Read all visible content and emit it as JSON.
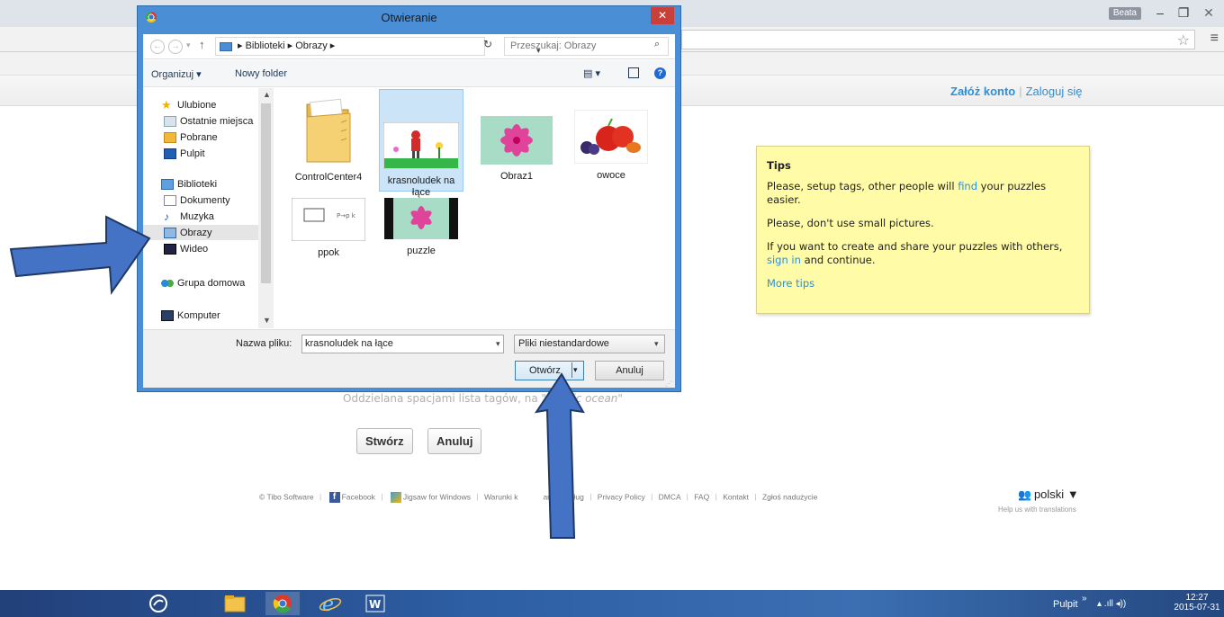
{
  "browser": {
    "user_badge": "Beata",
    "controls": {
      "minimize": "–",
      "maximize": "❐",
      "close": "✕"
    }
  },
  "site": {
    "header": {
      "signup": "Załóż konto",
      "separator": "|",
      "login": "Zaloguj się"
    },
    "tips": {
      "title": "Tips",
      "line1_pre": "Please, setup tags, other people will ",
      "line1_link": "find",
      "line1_post": " your puzzles easier.",
      "line2": "Please, don't use small pictures.",
      "line3_pre": "If you want to create and share your puzzles with others, ",
      "line3_link": "sign in",
      "line3_post": " and continue.",
      "more": "More tips"
    },
    "tags_hint": {
      "pre": "Oddzielana spacjami lista tagów, na",
      "example": "\"pacific ocean\""
    },
    "buttons": {
      "create": "Stwórz",
      "cancel": "Anuluj"
    },
    "footer": {
      "copyright": "© Tibo Software",
      "facebook": "Facebook",
      "jigsaw": "Jigsaw for Windows",
      "terms": "Warunki k",
      "terms_rest": "ania z usług",
      "privacy": "Privacy Policy",
      "dmca": "DMCA",
      "faq": "FAQ",
      "contact": "Kontakt",
      "report": "Zgłoś nadużycie",
      "sep": "|"
    },
    "language": {
      "current": "polski",
      "caret": "▼",
      "help": "Help us with translations"
    }
  },
  "dialog": {
    "title": "Otwieranie",
    "close": "✕",
    "nav": {
      "back": "←",
      "forward": "→",
      "recent": "▾",
      "up": "↑",
      "breadcrumb": "▸ Biblioteki ▸ Obrazy ▸",
      "address_dropdown": "▾",
      "refresh": "↻",
      "search_placeholder": "Przeszukaj: Obrazy",
      "search_icon": "⌕"
    },
    "commands": {
      "organize": "Organizuj ▾",
      "new_folder": "Nowy folder",
      "view": "▤ ▾",
      "help": "?"
    },
    "sidebar": [
      {
        "label": "Ulubione",
        "icon": "star-icon"
      },
      {
        "label": "Ostatnie miejsca",
        "icon": "recent-places-icon"
      },
      {
        "label": "Pobrane",
        "icon": "downloads-icon"
      },
      {
        "label": "Pulpit",
        "icon": "desktop-icon"
      },
      {
        "label": "Biblioteki",
        "icon": "libraries-icon"
      },
      {
        "label": "Dokumenty",
        "icon": "documents-icon"
      },
      {
        "label": "Muzyka",
        "icon": "music-icon"
      },
      {
        "label": "Obrazy",
        "icon": "pictures-icon"
      },
      {
        "label": "Wideo",
        "icon": "video-icon"
      },
      {
        "label": "Grupa domowa",
        "icon": "homegroup-icon"
      },
      {
        "label": "Komputer",
        "icon": "computer-icon"
      }
    ],
    "scroll": {
      "up": "▲",
      "down": "▼"
    },
    "files": [
      {
        "name": "ControlCenter4",
        "icon": "folder-icon"
      },
      {
        "name": "krasnoludek na łące",
        "icon": "image-thumbnail-icon"
      },
      {
        "name": "Obraz1",
        "icon": "image-thumbnail-icon"
      },
      {
        "name": "owoce",
        "icon": "image-thumbnail-icon"
      },
      {
        "name": "ppok",
        "icon": "image-thumbnail-icon"
      },
      {
        "name": "puzzle",
        "icon": "image-thumbnail-icon"
      }
    ],
    "footer": {
      "filename_label": "Nazwa pliku:",
      "filename_value": "krasnoludek na łące",
      "filename_dropdown": "▾",
      "filetype": "Pliki niestandardowe",
      "filetype_dropdown": "▾",
      "open": "Otwórz",
      "open_split": "▾",
      "cancel": "Anuluj",
      "grip": "⋰"
    }
  },
  "taskbar": {
    "pulpit": "Pulpit",
    "chevron": "»",
    "tray": "▴  .ıll  ◂))",
    "time": "12:27",
    "date": "2015-07-31"
  },
  "colors": {
    "accent_link": "#2c8fd8",
    "tips_bg": "#fffba6",
    "arrow_fill": "#4472c4",
    "arrow_stroke": "#1f3864"
  }
}
